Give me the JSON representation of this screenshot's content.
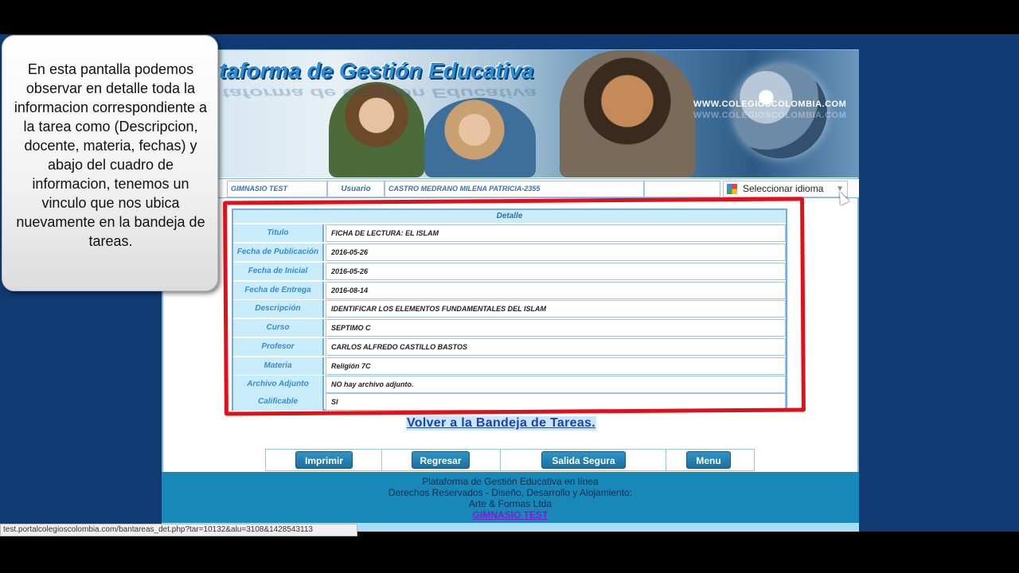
{
  "banner": {
    "title": "Plataforma de Gestión Educativa",
    "title_visible": "taforma de Gestión Educativa",
    "website": "WWW.COLEGIOSCOLOMBIA.COM"
  },
  "userbar": {
    "school": "GIMNASIO TEST",
    "user_label": "Usuario",
    "user_name": "CASTRO MEDRANO MILENA PATRICIA-2355",
    "language_select": "Seleccionar idioma"
  },
  "detail": {
    "heading": "Detalle",
    "rows": [
      {
        "label": "Titulo",
        "value": "FICHA DE LECTURA: EL ISLAM"
      },
      {
        "label": "Fecha de Publicación",
        "value": "2016-05-26"
      },
      {
        "label": "Fecha de Inicial",
        "value": "2016-05-26"
      },
      {
        "label": "Fecha de Entrega",
        "value": "2016-08-14"
      },
      {
        "label": "Descripción",
        "value": "IDENTIFICAR LOS ELEMENTOS FUNDAMENTALES DEL ISLAM"
      },
      {
        "label": "Curso",
        "value": "SEPTIMO C"
      },
      {
        "label": "Profesor",
        "value": "CARLOS ALFREDO CASTILLO BASTOS"
      },
      {
        "label": "Materia",
        "value": "Religión 7C"
      },
      {
        "label": "Archivo Adjunto",
        "value": "NO hay archivo adjunto."
      },
      {
        "label": "Calificable",
        "value": "SI"
      }
    ]
  },
  "back_link": "Volver a la Bandeja de Tareas.",
  "buttons": {
    "print": "Imprimir",
    "back": "Regresar",
    "logout": "Salida Segura",
    "menu": "Menu"
  },
  "footer": {
    "line1": "Plataforma de Gestión Educativa en línea",
    "line2": "Derechos Reservados - Diseño, Desarrollo y Alojamiento:",
    "line3": "Arte & Formas Ltda",
    "school_link": "GIMNASIO TEST"
  },
  "status_url": "test.portalcolegioscolombia.com/bantareas_det.php?tar=10132&alu=3108&1428543113",
  "callout": "En esta pantalla podemos observar en detalle toda la informacion correspondiente a la tarea como (Descripcion, docente, materia, fechas) y abajo del cuadro de informacion, tenemos un vinculo que nos ubica nuevamente en la bandeja de tareas.",
  "colors": {
    "background": "#0f3a72",
    "label_cell": "#c9ecfb",
    "highlight_box": "#e0101a",
    "footer": "#1888b8",
    "button": "#1a6f9f"
  }
}
